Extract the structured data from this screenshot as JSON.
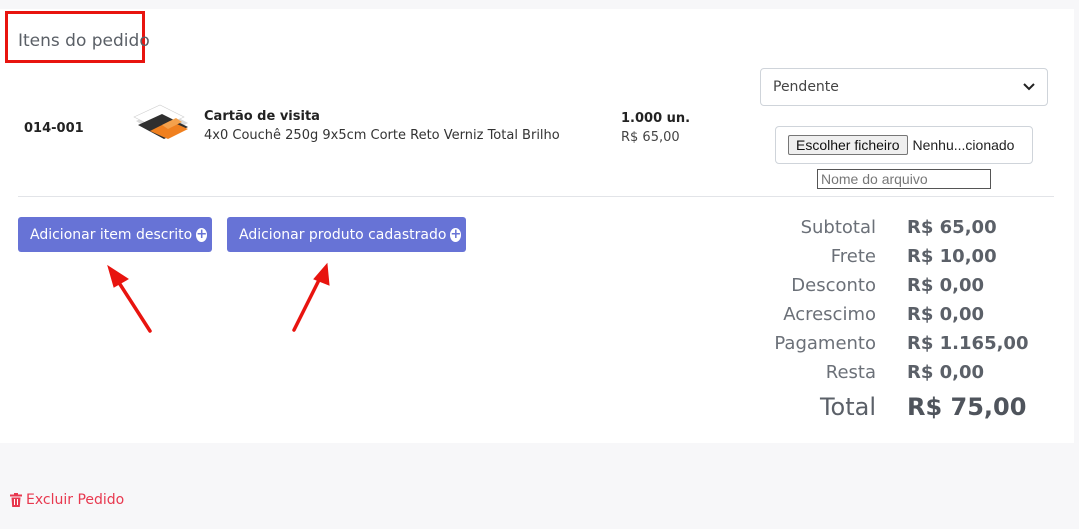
{
  "section": {
    "title": "Itens do pedido"
  },
  "item": {
    "code": "014-001",
    "name": "Cartão de visita",
    "description": "4x0 Couchê 250g 9x5cm Corte Reto Verniz Total Brilho",
    "quantity": "1.000 un.",
    "price": "R$ 65,00",
    "status_selected": "Pendente",
    "file_button_label": "Escolher ficheiro",
    "file_status": "Nenhu...cionado",
    "filename_placeholder": "Nome do arquivo"
  },
  "actions": {
    "add_described_item": "Adicionar item descrito",
    "add_registered_product": "Adicionar produto cadastrado"
  },
  "summary": [
    {
      "label": "Subtotal",
      "value": "R$ 65,00"
    },
    {
      "label": "Frete",
      "value": "R$ 10,00"
    },
    {
      "label": "Desconto",
      "value": "R$ 0,00"
    },
    {
      "label": "Acrescimo",
      "value": "R$ 0,00"
    },
    {
      "label": "Pagamento",
      "value": "R$ 1.165,00"
    },
    {
      "label": "Resta",
      "value": "R$ 0,00"
    }
  ],
  "total": {
    "label": "Total",
    "value": "R$ 75,00"
  },
  "footer": {
    "delete_label": "Excluir Pedido"
  },
  "colors": {
    "button": "#6773d6",
    "annotation_red": "#e8140f",
    "delete_red": "#e8384f"
  },
  "icons": {
    "select": "chevron-down-icon",
    "button": "plus-circle-icon",
    "delete": "trash-icon"
  }
}
